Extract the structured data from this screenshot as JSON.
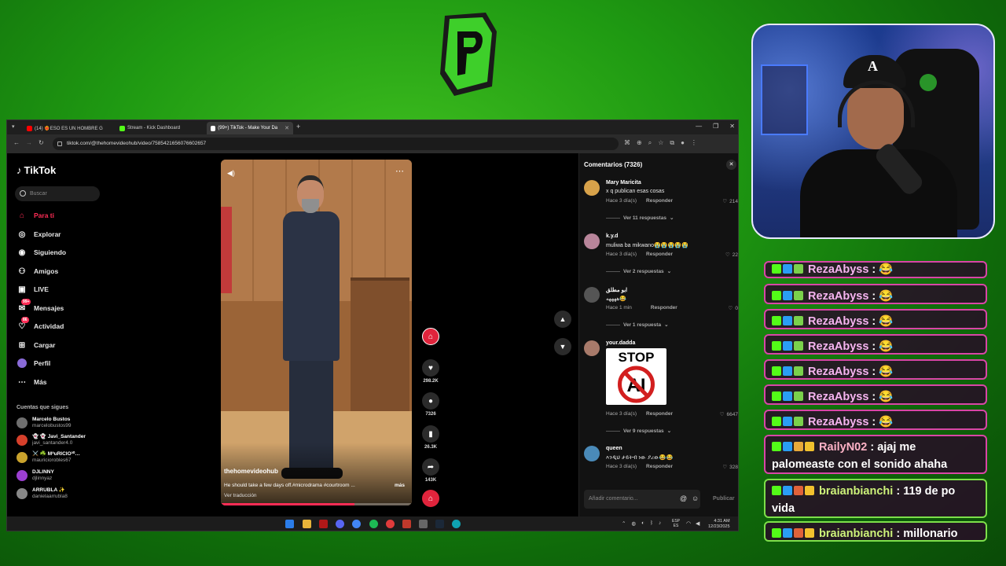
{
  "logo": {
    "icon": "play-logo"
  },
  "browser": {
    "tabs": [
      {
        "label": "(14) ❤️‍🔥ESO ES UN HOMBRE G",
        "icon": "youtube-icon",
        "color": "#ff0000"
      },
      {
        "label": "Stream - Kick Dashboard",
        "icon": "kick-icon",
        "color": "#53fc18"
      },
      {
        "label": "(99+) TikTok - Make Your Da",
        "icon": "tiktok-icon",
        "color": "#ffffff"
      }
    ],
    "url": "tiktok.com/@thehomevideohub/video/7585421656076602657"
  },
  "tiktok": {
    "brand": "TikTok",
    "search_placeholder": "Buscar",
    "nav": [
      {
        "label": "Para ti",
        "icon": "home-icon",
        "active": true
      },
      {
        "label": "Explorar",
        "icon": "compass-icon"
      },
      {
        "label": "Siguiendo",
        "icon": "following-icon"
      },
      {
        "label": "Amigos",
        "icon": "friends-icon"
      },
      {
        "label": "LIVE",
        "icon": "live-icon"
      },
      {
        "label": "Mensajes",
        "icon": "messages-icon",
        "badge": "99+"
      },
      {
        "label": "Actividad",
        "icon": "activity-icon",
        "badge": "86"
      },
      {
        "label": "Cargar",
        "icon": "upload-icon"
      },
      {
        "label": "Perfil",
        "icon": "profile-icon"
      },
      {
        "label": "Más",
        "icon": "more-icon"
      }
    ],
    "following_header": "Cuentas que sigues",
    "following": [
      {
        "name": "Marcelo  Bustos",
        "handle": "marcelobustos99"
      },
      {
        "name": "👻 👻 Javi_Santander",
        "handle": "javi_santander4.0"
      },
      {
        "name": "⚔️ ☘️ MªuRICIO³⁰…",
        "handle": "mauriciorobles67"
      },
      {
        "name": "DJLINNY",
        "handle": "djlinnyaz"
      },
      {
        "name": "ARRUBLA ✨",
        "handle": "danielaarrubla8"
      }
    ],
    "video": {
      "author": "thehomevideohub",
      "caption": "He should take a few days off.#microdrama #courtroom ...",
      "more": "más",
      "translate": "Ver traducción",
      "progress": 0.7
    },
    "actions": {
      "likes": "298.2K",
      "comments": "7326",
      "saves": "26.3K",
      "shares": "143K"
    },
    "comments_panel": {
      "title": "Comentarios (7326)",
      "reply_label": "Responder",
      "input_placeholder": "Añadir comentario...",
      "post_label": "Publicar",
      "items": [
        {
          "user": "Mary Maricita",
          "text": "x q publican esas cosas",
          "time": "Hace 3 día(s)",
          "likes": "214",
          "replies": "Ver 11 respuestas"
        },
        {
          "user": "k.y.d",
          "text": "muliwa ba mikwano😭😭😭😭😭",
          "time": "Hace 3 día(s)",
          "likes": "22",
          "replies": "Ver 2 respuestas"
        },
        {
          "user": "ابو مطلق",
          "text": "ههههه😂",
          "time": "Hace 1 min",
          "likes": "0",
          "replies": "Ver 1 respuesta"
        },
        {
          "user": "your.dadda",
          "text": "",
          "image_text": "STOP",
          "image_sub": "AI",
          "time": "Hace 3 día(s)",
          "likes": "6647",
          "replies": "Ver 9 respuestas"
        },
        {
          "user": "queen",
          "text": "እንዲህ ታይትብ ነው ያረው😂😂",
          "time": "Hace 3 día(s)",
          "likes": "328",
          "replies": ""
        }
      ]
    }
  },
  "taskbar": {
    "lang_top": "ESP",
    "lang_bottom": "ES",
    "time": "4:31 AM",
    "date": "12/23/2025"
  },
  "chat": {
    "messages": [
      {
        "user": "RezaAbyss",
        "text": "😂"
      },
      {
        "user": "RezaAbyss",
        "text": "😂"
      },
      {
        "user": "RezaAbyss",
        "text": "😂"
      },
      {
        "user": "RezaAbyss",
        "text": "😂"
      },
      {
        "user": "RezaAbyss",
        "text": "😂"
      },
      {
        "user": "RezaAbyss",
        "text": "😂"
      },
      {
        "user": "RezaAbyss",
        "text": "😂"
      },
      {
        "user": "RailyN02",
        "text": "ajaj me palomeaste con el sonido ahaha"
      },
      {
        "user": "braianbianchi",
        "text": "119 de po vida"
      },
      {
        "user": "braianbianchi",
        "text": "millonario"
      }
    ]
  },
  "colors": {
    "accent": "#fe2c55",
    "kick": "#53fc18",
    "chat_border": "#d846a6"
  }
}
